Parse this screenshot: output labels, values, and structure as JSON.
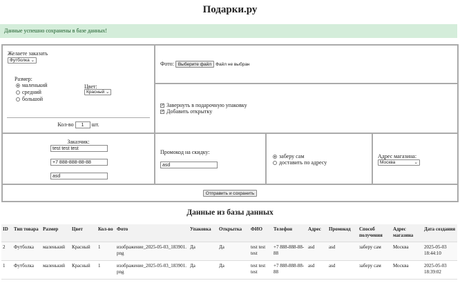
{
  "title": "Подарки.ру",
  "alert": "Данные успешно сохранены в базе данных!",
  "form": {
    "order_label": "Желаете заказать",
    "product": "Футболка",
    "size_label": "Размер:",
    "sizes": [
      "маленький",
      "средний",
      "большой"
    ],
    "color_label": "Цвет:",
    "color": "Красный",
    "qty_label": "Кол-во",
    "qty": "1",
    "qty_unit": "шт.",
    "photo_label": "Фото:",
    "file_button": "Выберите файл",
    "file_status": "Файл не выбран",
    "wrap_label": "Завернуть в подарочную упаковку",
    "card_label": "Добавить открытку",
    "customer_label": "Заказчик:",
    "name": "test test test",
    "phone": "+7 888-888-88-88",
    "address": "asd",
    "promo_label": "Промокод на скидку:",
    "promo": "asd",
    "delivery": [
      "заберу сам",
      "доставить по адресу"
    ],
    "store_label": "Адрес магазина:",
    "store": "Москва",
    "submit": "Отправить и сохранить"
  },
  "db_title": "Данные из базы данных",
  "table": {
    "headers": [
      "ID",
      "Тип товара",
      "Размер",
      "Цвет",
      "Кол-во",
      "Фото",
      "Упаковка",
      "Открытка",
      "ФИО",
      "Телефон",
      "Адрес",
      "Промокод",
      "Способ получения",
      "Адрес магазина",
      "Дата создания"
    ],
    "rows": [
      [
        "2",
        "Футболка",
        "маленький",
        "Красный",
        "1",
        "изображение_2025-05-03_183901.png",
        "Да",
        "Да",
        "test test test",
        "+7 888-888-88-88",
        "asd",
        "asd",
        "заберу сам",
        "Москва",
        "2025-05-03 18:44:10"
      ],
      [
        "1",
        "Футболка",
        "маленький",
        "Красный",
        "1",
        "изображение_2025-05-03_183901.png",
        "Да",
        "Да",
        "test test test",
        "+7 888-888-88-88",
        "asd",
        "asd",
        "заберу сам",
        "Москва",
        "2025-05-03 18:39:02"
      ]
    ]
  }
}
